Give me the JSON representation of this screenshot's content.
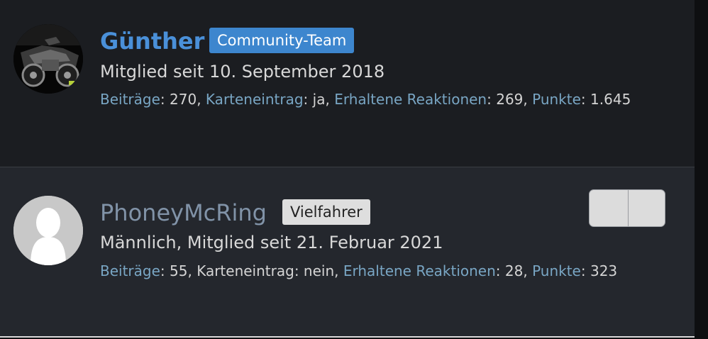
{
  "members": [
    {
      "name": "Günther",
      "badge": "Community-Team",
      "member_since": "Mitglied seit 10. September 2018",
      "gender": "",
      "stats": {
        "posts_label": "Beiträge",
        "posts_value": "270",
        "map_label": "Karteneintrag",
        "map_value": "ja",
        "reactions_label": "Erhaltene Reaktionen",
        "reactions_value": "269",
        "points_label": "Punkte",
        "points_value": "1.645"
      },
      "colors": {
        "name": "#4a90d9",
        "badge_bg": "#3d86ce"
      },
      "avatar_icon": "motorcycle-photo"
    },
    {
      "name": "PhoneyMcRing",
      "badge": "Vielfahrer",
      "member_since": "Mitglied seit 21. Februar 2021",
      "gender": "Männlich,",
      "stats": {
        "posts_label": "Beiträge",
        "posts_value": "55",
        "map_label": "Karteneintrag",
        "map_value": "nein",
        "reactions_label": "Erhaltene Reaktionen",
        "reactions_value": "28",
        "points_label": "Punkte",
        "points_value": "323"
      },
      "colors": {
        "name": "#8193a8",
        "badge_bg": "#dedede"
      },
      "avatar_icon": "default-user-silhouette",
      "action_toggle": "two-segment-button"
    }
  ]
}
